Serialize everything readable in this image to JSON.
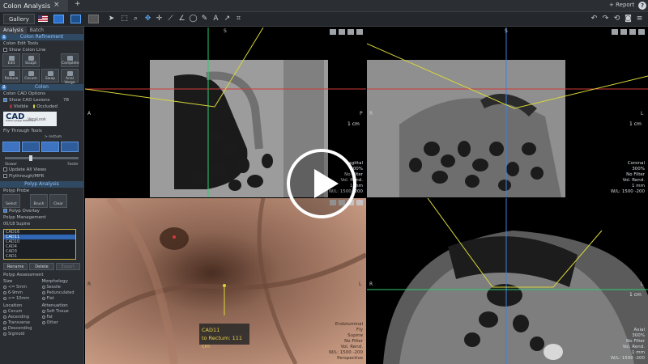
{
  "app": {
    "tab_title": "Colon Analysis",
    "tab_close": "×",
    "tab_add": "+",
    "report_label": "+ Report",
    "help_label": "?"
  },
  "toolbar": {
    "gallery_label": "Gallery",
    "icons": [
      "pointer-icon",
      "zoom-icon",
      "pan-icon",
      "measure-icon",
      "angle-icon",
      "ellipse-icon",
      "freehand-icon",
      "text-icon",
      "arrow-icon",
      "crop-icon"
    ]
  },
  "panel": {
    "tabs": [
      "Analysis",
      "Batch"
    ],
    "colon_refinement": {
      "title": "Colon Refinement",
      "number": "1",
      "edit_tools_label": "Colon Edit Tools",
      "show_colon_line": "Show Colon Line",
      "row1": [
        "Edit",
        "Sculpt",
        "",
        "Complete"
      ],
      "row2": [
        "Reduce",
        "Cecum",
        "Swap",
        "Anal Verge"
      ]
    },
    "colon": {
      "title": "Colon",
      "number": "2",
      "cad_options": "Colon CAD Options",
      "show_cad": "Show CAD Lesions",
      "cad_count": "78",
      "visible": "Visible",
      "occluded": "Occluded",
      "logo_text": "CAD",
      "logo_sub": "VeraLook",
      "logo_tag": "Colon polyp detection",
      "fly_through": "Fly Through Tools",
      "rectum_label": "> rectum",
      "slower": "Slower",
      "faster": "Faster",
      "update_all": "Update All Views",
      "flythrough_mpr": "Flythrough/MPR"
    },
    "polyp_analysis": {
      "title": "Polyp Analysis",
      "polyp_probe": "Polyp Probe",
      "tools": [
        "Select",
        "Brush",
        "Clear"
      ],
      "polyp_overlay": "Polyp Overlay",
      "management": "Polyp Management",
      "list_header": "00/18 Supine",
      "list_items": [
        "CAD16",
        "CAD11",
        "CAD10",
        "CAD4",
        "CAD3",
        "CAD1"
      ],
      "selected_index": 1,
      "buttons": [
        "Rename",
        "Delete",
        "Export"
      ],
      "assessment": "Polyp Assessment",
      "size_label": "Size",
      "sizes": [
        "<= 5mm",
        "6-9mm",
        ">= 10mm"
      ],
      "morphology_label": "Morphology",
      "morphologies": [
        "Sessile",
        "Pedunculated",
        "Flat"
      ],
      "location_label": "Location",
      "locations": [
        "Cecum",
        "Ascending",
        "Transverse",
        "Descending",
        "Sigmoid"
      ],
      "attenuation_label": "Attenuation",
      "attenuations": [
        "Soft Tissue",
        "Fat",
        "Other"
      ]
    }
  },
  "viewports": {
    "top_left": {
      "orient_top": "S",
      "orient_left": "A",
      "orient_right": "P",
      "scale": "1 cm",
      "info": [
        "Sagittal",
        "300%",
        "No Filter",
        "Vol. Rend.",
        "1 mm",
        "W/L: 1500 -200"
      ]
    },
    "top_right": {
      "orient_top": "S",
      "orient_left": "R",
      "orient_right": "L",
      "scale": "1 cm",
      "info": [
        "Coronal",
        "300%",
        "No Filter",
        "Vol. Rend.",
        "1 mm",
        "W/L: 1500 -200"
      ]
    },
    "bottom_left": {
      "orient_left": "R",
      "orient_right": "L",
      "tooltip_line1": "CAD11",
      "tooltip_line2": "to Rectum: 111 cm",
      "info": [
        "Endoluminal",
        "Fly",
        "Supine",
        "No Filter",
        "Vol. Rend.",
        "W/L: 1500 -200",
        "Perspective"
      ]
    },
    "bottom_right": {
      "orient_left": "R",
      "orient_right": "L",
      "scale": "1 cm",
      "info": [
        "Axial",
        "300%",
        "No Filter",
        "Vol. Rend.",
        "1 mm",
        "W/L: 1500 -200"
      ]
    }
  },
  "colors": {
    "accent": "#3a7fd0",
    "section_header": "#314a63",
    "crosshair_green": "#2ecc71",
    "crosshair_blue": "#3d7fe0",
    "crosshair_red": "#d23a3a",
    "path_yellow": "#d9d73a",
    "endo_tissue": "#b58a72"
  }
}
